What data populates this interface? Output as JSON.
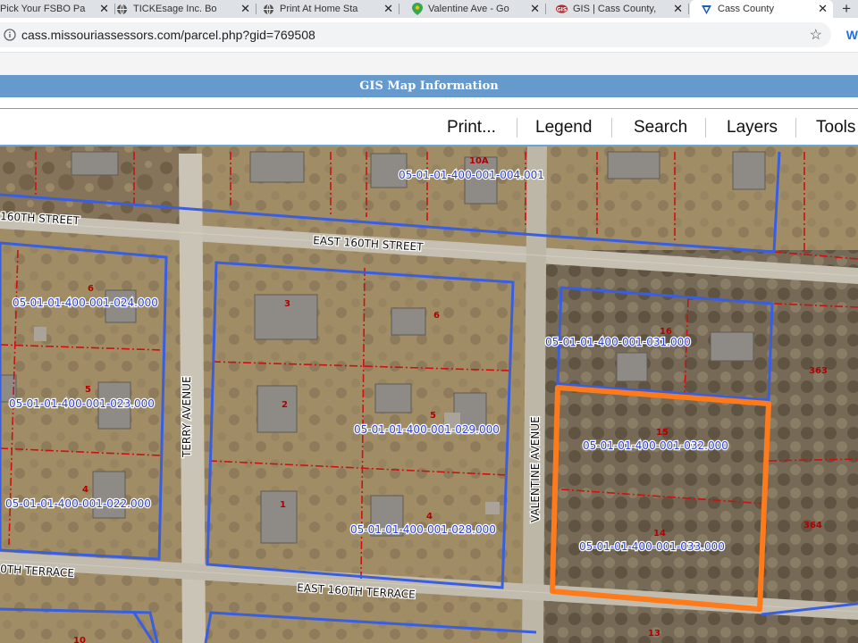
{
  "browser": {
    "tabs": [
      {
        "title": "Pick Your FSBO Pa",
        "icon": "page-icon",
        "active": false
      },
      {
        "title": "TICKEsage Inc. Bo",
        "icon": "globe-icon",
        "active": false
      },
      {
        "title": "Print At Home Sta",
        "icon": "globe-icon",
        "active": false
      },
      {
        "title": "Valentine Ave - Go",
        "icon": "maps-pin-icon",
        "active": false
      },
      {
        "title": "GIS | Cass County,",
        "icon": "gis-logo-icon",
        "active": false
      },
      {
        "title": "Cass County",
        "icon": "assessor-logo-icon",
        "active": true
      }
    ],
    "close_glyph": "✕",
    "new_tab_glyph": "+",
    "url": "cass.missouriassessors.com/parcel.php?gid=769508",
    "extension_label": "W"
  },
  "gis": {
    "header_title": "GIS Map Information",
    "menu": [
      "Print...",
      "Legend",
      "Search",
      "Layers",
      "Tools"
    ]
  },
  "map": {
    "streets": [
      "EAST 160TH STREET",
      "160TH STREET",
      "EAST 160TH TERRACE",
      "0TH TERRACE",
      "TERRY AVENUE",
      "VALENTINE AVENUE"
    ],
    "parcel_ids": [
      "05-01-01-400-001-004.001",
      "05-01-01-400-001-024.000",
      "05-01-01-400-001-023.000",
      "05-01-01-400-001-022.000",
      "05-01-01-400-001-029.000",
      "05-01-01-400-001-028.000",
      "05-01-01-400-001-031.000",
      "05-01-01-400-001-032.000",
      "05-01-01-400-001-033.000"
    ],
    "lot_numbers": [
      "10A",
      "6",
      "5",
      "4",
      "3",
      "6",
      "2",
      "5",
      "1",
      "4",
      "16",
      "15",
      "14",
      "13",
      "10",
      "363",
      "364"
    ],
    "colors": {
      "parcel_outline": "#3a5ee0",
      "lot_line": "#cc1111",
      "selected": "#ff7a1a",
      "label": "#2a3fd8",
      "label_halo": "#ffffff"
    }
  }
}
